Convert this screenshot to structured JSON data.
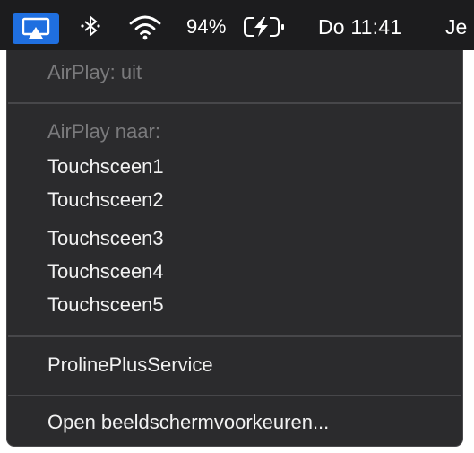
{
  "menubar": {
    "icons": {
      "airplay": "airplay-icon",
      "bluetooth": "bluetooth-icon",
      "wifi": "wifi-icon",
      "battery": "battery-charging-icon"
    },
    "battery_percent": "94%",
    "clock": "Do 11:41",
    "user": "Je",
    "accent_color": "#1f6fe0"
  },
  "menu": {
    "airplay_status": "AirPlay: uit",
    "airplay_to_header": "AirPlay naar:",
    "devices": [
      "Touchsceen1",
      "Touchsceen2",
      "Touchsceen3",
      "Touchsceen4",
      "Touchsceen5"
    ],
    "service": "ProlinePlusService",
    "open_prefs": "Open beeldschermvoorkeuren..."
  }
}
